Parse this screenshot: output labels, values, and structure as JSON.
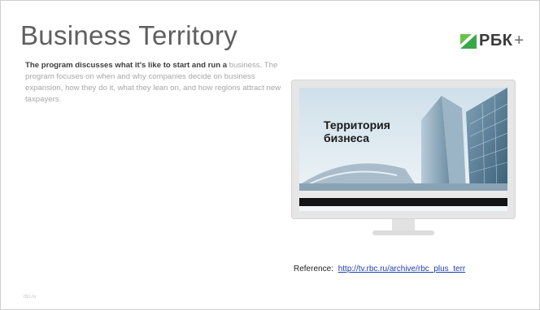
{
  "slide": {
    "title": "Business Territory",
    "logo_text": "РБК",
    "logo_plus": "+",
    "description_lead": "The program discusses what it's like to start and run a",
    "description_rest": "business. The program focuses on when and why companies decide on business expansion, how they do it, what they lean on, and how regions attract new taxpayers.",
    "screen": {
      "show_title_line1": "Территория",
      "show_title_line2": "бизнеса"
    },
    "reference_label": "Reference:",
    "reference_link": "http://tv.rbc.ru/archive/rbc_plus_terr",
    "footer": "rbc.ru"
  },
  "colors": {
    "logo_green": "#3aa64a",
    "link_blue": "#1f3fb0"
  }
}
